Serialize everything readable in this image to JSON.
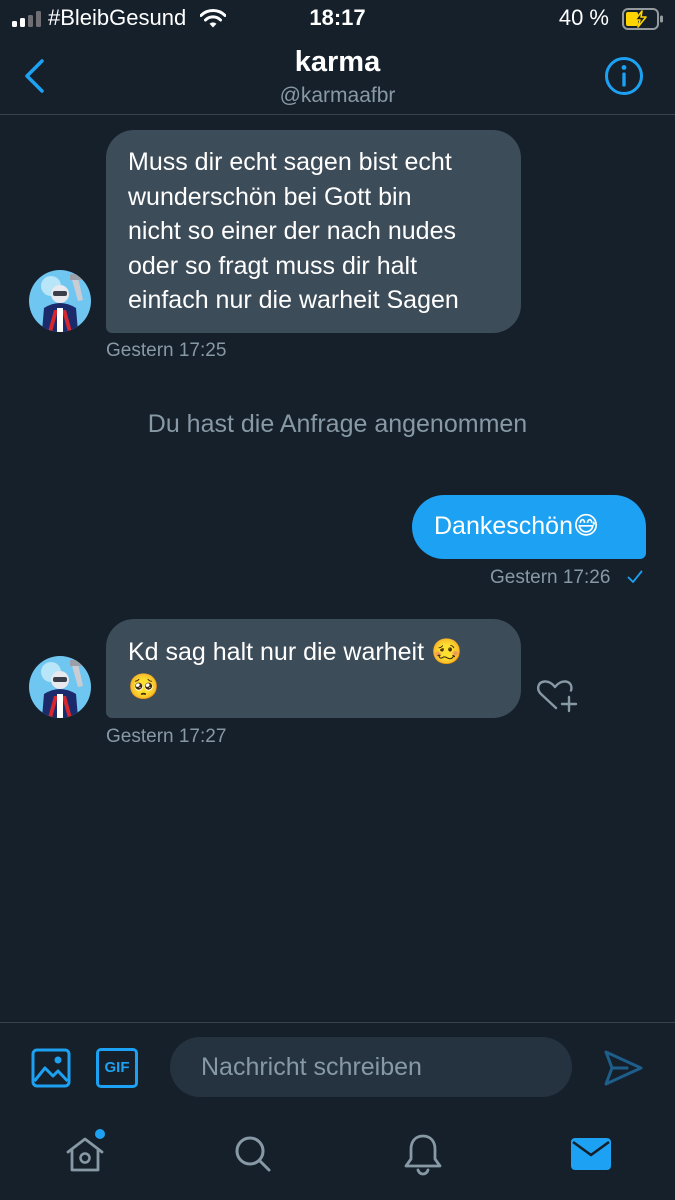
{
  "status_bar": {
    "carrier": "#BleibGesund",
    "time": "18:17",
    "battery_percent": "40 %",
    "signal_bars_active": 2
  },
  "header": {
    "name": "karma",
    "handle": "@karmaafbr",
    "back_icon": "chevron-left-icon",
    "info_icon": "info-icon"
  },
  "messages": [
    {
      "direction": "incoming",
      "text": "Muss dir echt sagen bist echt wunderschön bei Gott bin nicht so einer der nach nudes oder so fragt muss dir halt einfach nur die warheit Sagen",
      "lines": [
        "Muss dir echt sagen bist echt",
        "wunderschön bei Gott bin",
        "nicht so einer der nach nudes",
        "oder so fragt muss dir halt",
        "einfach nur die warheit Sagen"
      ],
      "timestamp": "Gestern 17:25"
    },
    {
      "direction": "system",
      "text": "Du hast die Anfrage angenommen"
    },
    {
      "direction": "outgoing",
      "text": "Dankeschön",
      "emoji": "😅",
      "timestamp": "Gestern 17:26",
      "status_icon": "checkmark-icon"
    },
    {
      "direction": "incoming",
      "text": "Kd sag halt nur die warheit",
      "emoji": [
        "🥴",
        "🥺"
      ],
      "timestamp": "Gestern 17:27",
      "reaction_icon": "heart-plus-icon"
    }
  ],
  "composer": {
    "placeholder": "Nachricht schreiben",
    "gif_label": "GIF"
  },
  "tab_bar": {
    "items": [
      "home-icon",
      "search-icon",
      "notifications-icon",
      "messages-icon"
    ],
    "active": "messages-icon"
  },
  "colors": {
    "background": "#15202b",
    "accent": "#1da1f2",
    "incoming_bubble": "#3d4c59",
    "secondary_text": "#8899a6",
    "divider": "#38444d",
    "battery_charging": "#ffd400"
  }
}
